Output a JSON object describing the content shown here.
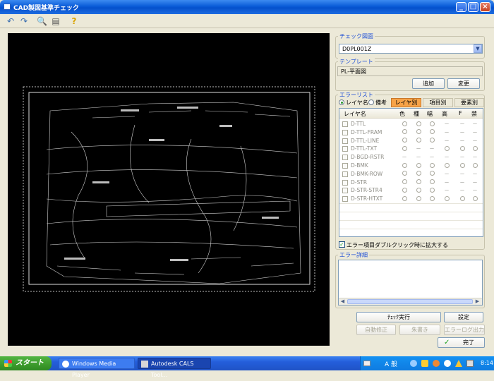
{
  "window": {
    "title": "CAD製図基準チェック"
  },
  "toolbar": {
    "icons": [
      "undo-icon",
      "redo-icon",
      "search-icon",
      "document-icon",
      "help-icon"
    ]
  },
  "check_drawing": {
    "label": "チェック図面",
    "value": "D0PL001Z"
  },
  "template": {
    "label": "テンプレート",
    "value": "PL-平面図",
    "add_label": "追加",
    "change_label": "変更"
  },
  "error_list": {
    "label": "エラーリスト",
    "radio_layer": "レイヤ名",
    "radio_note": "備考",
    "tabs": [
      "レイヤ別",
      "項目別",
      "要素別"
    ],
    "columns": [
      "レイヤ名",
      "色",
      "種",
      "幅",
      "高",
      "F",
      "禁"
    ],
    "rows": [
      {
        "name": "D-TTL",
        "cells": [
          "○",
          "○",
          "○",
          "－",
          "－",
          "－"
        ]
      },
      {
        "name": "D-TTL-FRAM",
        "cells": [
          "○",
          "○",
          "○",
          "－",
          "－",
          "－"
        ]
      },
      {
        "name": "D-TTL-LINE",
        "cells": [
          "○",
          "○",
          "○",
          "－",
          "－",
          "－"
        ]
      },
      {
        "name": "D-TTL-TXT",
        "cells": [
          "○",
          "－",
          "－",
          "○",
          "○",
          "○"
        ]
      },
      {
        "name": "D-BGD-RSTR",
        "cells": [
          "－",
          "－",
          "－",
          "－",
          "－",
          "－"
        ]
      },
      {
        "name": "D-BMK",
        "cells": [
          "○",
          "○",
          "○",
          "○",
          "○",
          "○"
        ]
      },
      {
        "name": "D-BMK-ROW",
        "cells": [
          "○",
          "○",
          "○",
          "－",
          "－",
          "－"
        ]
      },
      {
        "name": "D-STR",
        "cells": [
          "○",
          "○",
          "○",
          "－",
          "－",
          "－"
        ]
      },
      {
        "name": "D-STR-STR4",
        "cells": [
          "○",
          "○",
          "○",
          "－",
          "－",
          "－"
        ]
      },
      {
        "name": "D-STR-HTXT",
        "cells": [
          "○",
          "○",
          "○",
          "○",
          "○",
          "○"
        ]
      }
    ],
    "zoom_checkbox_label": "エラー項目ダブルクリック時に拡大する",
    "zoom_checked": true
  },
  "error_detail": {
    "label": "エラー詳細"
  },
  "buttons": {
    "run_check": "ﾁｪｯｸ実行",
    "settings": "設定",
    "auto_fix": "自動修正",
    "red_write": "朱書き",
    "error_log": "エラーログ出力",
    "done": "完了"
  },
  "taskbar": {
    "start": "スタート",
    "tasks": [
      "Windows Media Player",
      "Autodesk CALS Tool..."
    ],
    "tray_text": "A 般",
    "clock": "8:14"
  },
  "colors": {
    "active_tab": "#f7a348",
    "group_label": "#1e4fd6",
    "canvas": "#000000"
  }
}
